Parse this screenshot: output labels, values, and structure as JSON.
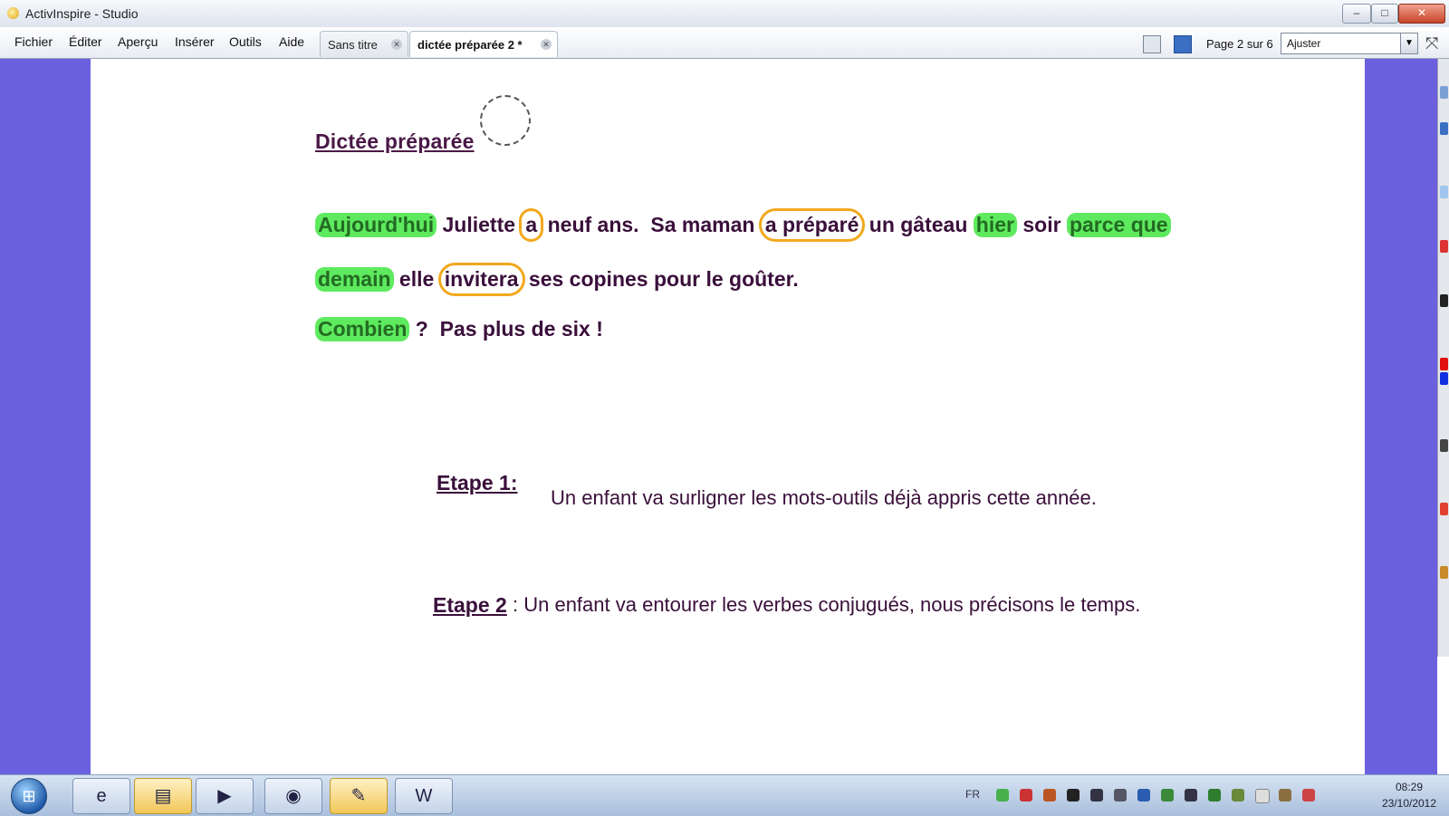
{
  "window": {
    "title": "ActivInspire - Studio",
    "minimize": "–",
    "maximize": "□",
    "close": "✕"
  },
  "menu": [
    "Fichier",
    "Éditer",
    "Aperçu",
    "Insérer",
    "Outils",
    "Aide"
  ],
  "tabs": [
    {
      "label": "Sans titre",
      "active": false
    },
    {
      "label": "dictée préparée 2 *",
      "active": true
    }
  ],
  "toolbar": {
    "page_indicator": "Page 2 sur 6",
    "zoom_value": "Ajuster"
  },
  "document": {
    "title": "Dictée préparée",
    "line1": {
      "w1": "Aujourd'hui",
      "w2": " Juliette ",
      "w3": "a",
      "w4": " neuf ans.  Sa maman ",
      "w5": "a préparé",
      "w6": " un gâteau ",
      "w7": "hier",
      "w8": " soir ",
      "w9": "parce que"
    },
    "line2": {
      "w1": "demain",
      "w2": " elle ",
      "w3": "invitera",
      "w4": " ses copines pour le goûter."
    },
    "line3": {
      "w1": "Combien",
      "w2": " ?  Pas plus de six !"
    },
    "step1": {
      "label": "Etape 1:",
      "text": "Un enfant va surligner les mots-outils déjà appris cette année."
    },
    "step2": {
      "label": "Etape 2",
      "text": ": Un enfant va entourer les verbes conjugués, nous précisons le temps."
    }
  },
  "colors": {
    "highlight": "#5eea5e",
    "circle": "#f2a81e",
    "workspace": "#6b60e0",
    "text": "#3a0f3a"
  },
  "taskbar": {
    "apps": [
      {
        "name": "internet-explorer",
        "glyph": "e"
      },
      {
        "name": "explorer",
        "glyph": "▤"
      },
      {
        "name": "media-player",
        "glyph": "▶"
      },
      {
        "name": "dell",
        "glyph": "◉"
      },
      {
        "name": "activinspire",
        "glyph": "✎"
      },
      {
        "name": "word",
        "glyph": "W"
      }
    ],
    "tray_lang": "FR",
    "clock_time": "08:29",
    "clock_date": "23/10/2012"
  }
}
